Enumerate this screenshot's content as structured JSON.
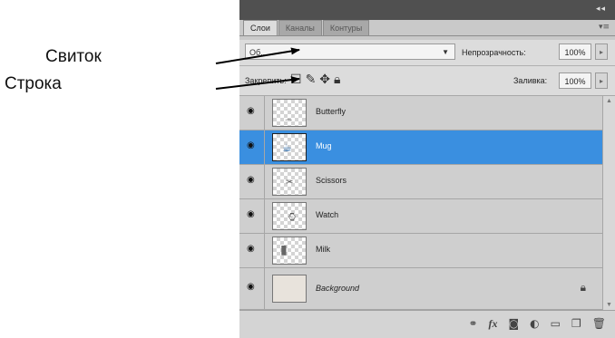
{
  "annotations": {
    "svitok": "Свиток",
    "stroka": "Строка"
  },
  "panel": {
    "tabs": [
      {
        "label": "Слои",
        "active": true
      },
      {
        "label": "Каналы",
        "active": false
      },
      {
        "label": "Контуры",
        "active": false
      }
    ],
    "blend_mode": "Об...",
    "opacity_label": "Непрозрачность:",
    "opacity_value": "100%",
    "lock_label": "Закрепить:",
    "fill_label": "Заливка:",
    "fill_value": "100%",
    "layers": [
      {
        "name": "Butterfly",
        "selected": false,
        "visible": true
      },
      {
        "name": "Mug",
        "selected": true,
        "visible": true
      },
      {
        "name": "Scissors",
        "selected": false,
        "visible": true
      },
      {
        "name": "Watch",
        "selected": false,
        "visible": true
      },
      {
        "name": "Milk",
        "selected": false,
        "visible": true
      },
      {
        "name": "Background",
        "selected": false,
        "visible": true,
        "locked": true
      }
    ],
    "bottom_icons": [
      "link-icon",
      "fx-icon",
      "mask-icon",
      "adjustment-icon",
      "folder-icon",
      "new-layer-icon",
      "trash-icon"
    ]
  },
  "colors": {
    "selection": "#3a8fe0",
    "panel_bg": "#c9c9c9"
  }
}
